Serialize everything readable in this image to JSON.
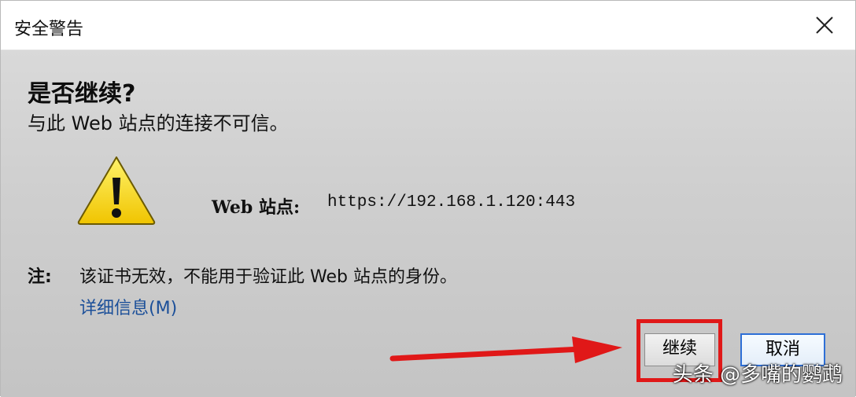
{
  "window": {
    "title": "安全警告"
  },
  "heading": "是否继续?",
  "subtext": "与此 Web 站点的连接不可信。",
  "site": {
    "label": "Web 站点:",
    "url": "https://192.168.1.120:443"
  },
  "note": {
    "label": "注:",
    "text": "该证书无效，不能用于验证此 Web 站点的身份。"
  },
  "details_link": "详细信息(M)",
  "buttons": {
    "continue": "继续",
    "cancel": "取消"
  },
  "watermark": "头条 @多嘴的鹦鹉",
  "colors": {
    "highlight": "#e01818",
    "arrow": "#e01818",
    "link": "#1b4f99",
    "warning_yellow": "#f5d800"
  },
  "icons": {
    "warning": "warning-triangle-icon",
    "close": "close-icon"
  }
}
